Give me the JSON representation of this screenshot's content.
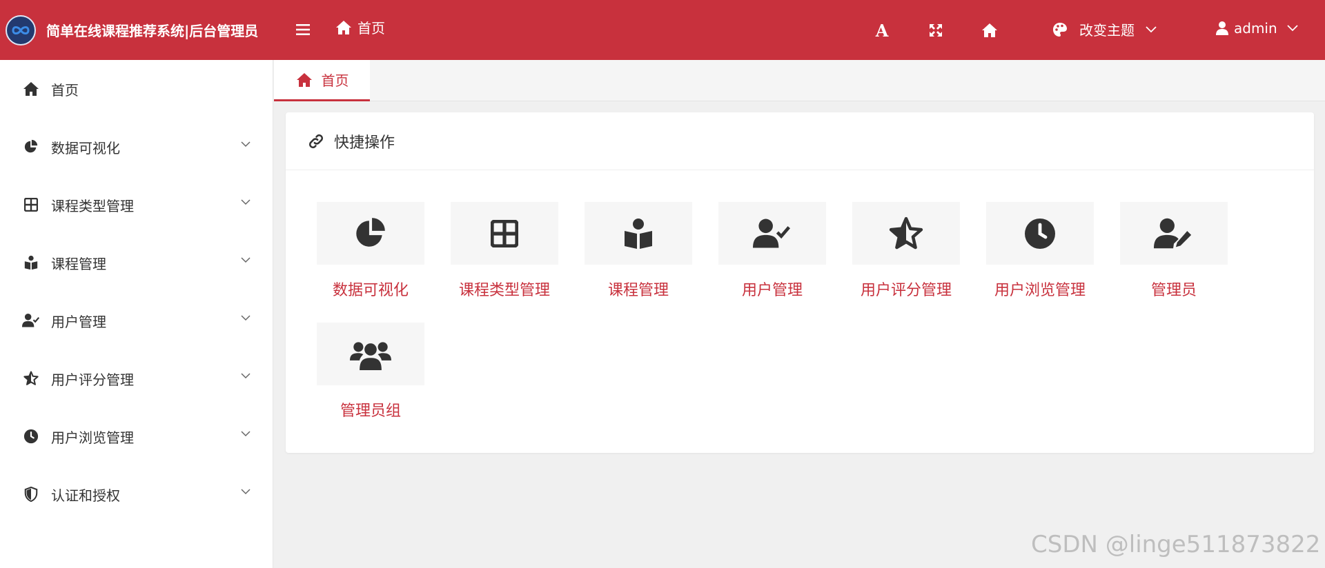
{
  "colors": {
    "primary": "#c8313d",
    "sidebar_bg": "#ffffff",
    "content_bg": "#f0f0f0"
  },
  "header": {
    "logo_icon": "infinity-logo",
    "app_title": "简单在线课程推荐系统|后台管理员",
    "menu_toggle_icon": "hamburger-icon",
    "home_label": "首页",
    "font_icon": "A",
    "fullscreen_icon": "fullscreen-icon",
    "home_icon": "home-icon",
    "theme_label": "改变主题",
    "user_label": "admin"
  },
  "sidebar": {
    "items": [
      {
        "label": "首页",
        "icon": "home-icon",
        "has_children": false
      },
      {
        "label": "数据可视化",
        "icon": "pie-chart-icon",
        "has_children": true
      },
      {
        "label": "课程类型管理",
        "icon": "grid-icon",
        "has_children": true
      },
      {
        "label": "课程管理",
        "icon": "book-reader-icon",
        "has_children": true
      },
      {
        "label": "用户管理",
        "icon": "user-check-icon",
        "has_children": true
      },
      {
        "label": "用户评分管理",
        "icon": "star-half-icon",
        "has_children": true
      },
      {
        "label": "用户浏览管理",
        "icon": "clock-icon",
        "has_children": true
      },
      {
        "label": "认证和授权",
        "icon": "shield-icon",
        "has_children": true
      }
    ]
  },
  "tabs": [
    {
      "label": "首页",
      "icon": "home-icon",
      "active": true
    }
  ],
  "panel": {
    "title": "快捷操作",
    "title_icon": "link-icon",
    "shortcuts": [
      {
        "label": "数据可视化",
        "icon": "pie-chart-icon"
      },
      {
        "label": "课程类型管理",
        "icon": "grid-icon"
      },
      {
        "label": "课程管理",
        "icon": "book-reader-icon"
      },
      {
        "label": "用户管理",
        "icon": "user-check-icon"
      },
      {
        "label": "用户评分管理",
        "icon": "star-half-icon"
      },
      {
        "label": "用户浏览管理",
        "icon": "clock-icon"
      },
      {
        "label": "管理员",
        "icon": "user-edit-icon"
      },
      {
        "label": "管理员组",
        "icon": "users-icon"
      }
    ]
  },
  "watermark": "CSDN @linge511873822"
}
